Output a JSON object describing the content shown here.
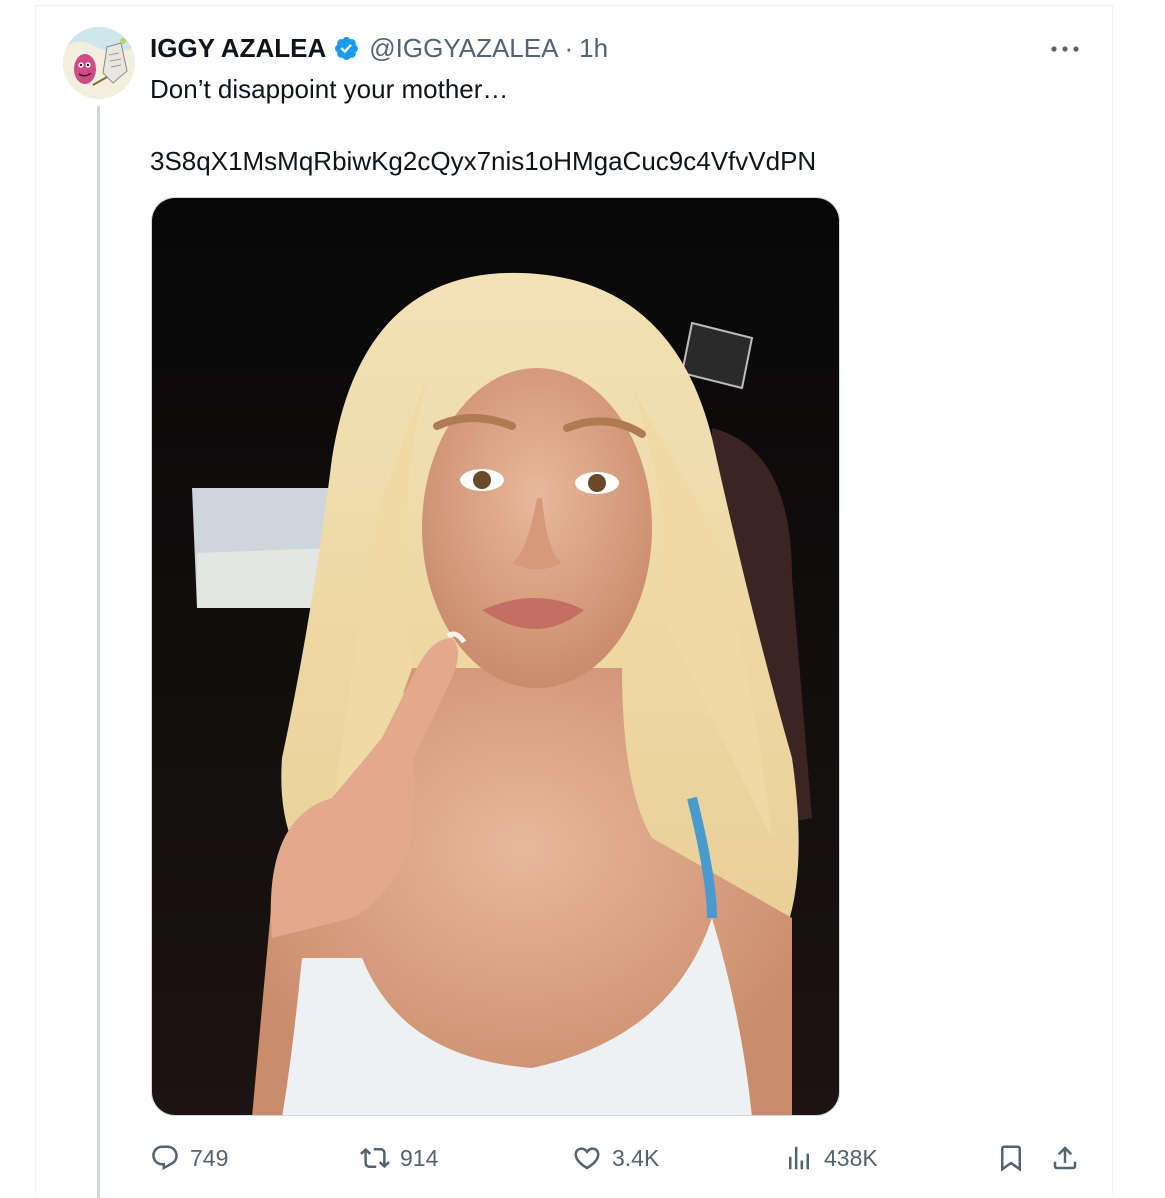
{
  "tweet": {
    "display_name": "IGGY AZALEA",
    "handle": "@IGGYAZALEA",
    "separator": "·",
    "time": "1h",
    "text_line1": "Don’t disappoint your mother…",
    "text_line2": "3S8qX1MsMqRbiwKg2cQyx7nis1oHMgaCuc9c4VfvVdPN"
  },
  "media": {
    "description": "selfie photo in car"
  },
  "actions": {
    "replies": "749",
    "reposts": "914",
    "likes": "3.4K",
    "views": "438K"
  },
  "icons": {
    "avatar": "avatar-illustration",
    "verified": "verified-badge-icon",
    "more": "more-horizontal-icon",
    "reply": "reply-icon",
    "repost": "repost-icon",
    "like": "heart-icon",
    "views": "analytics-icon",
    "bookmark": "bookmark-icon",
    "share": "share-icon"
  },
  "colors": {
    "text": "#0f1419",
    "secondary": "#536471",
    "verified": "#1d9bf0",
    "border": "#cfd9de"
  }
}
